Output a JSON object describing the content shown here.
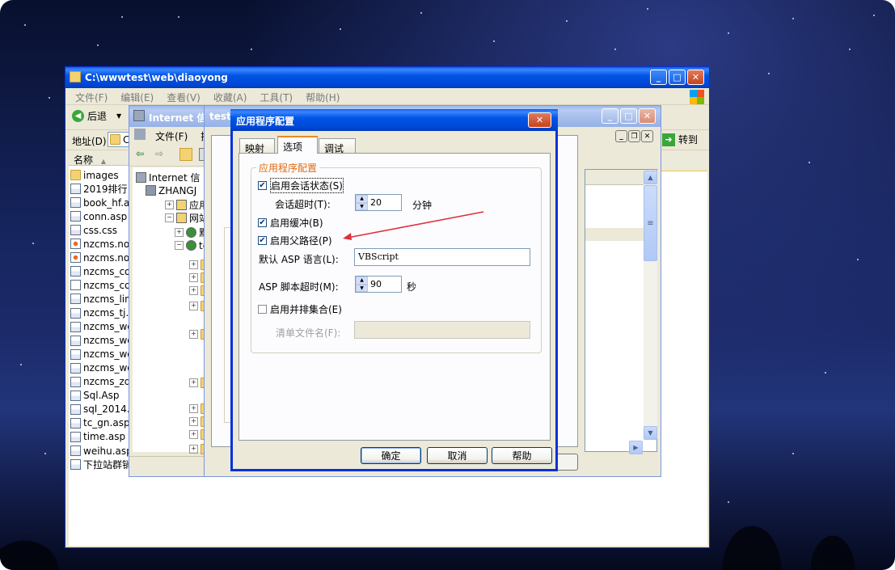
{
  "explorer": {
    "title": "C:\\wwwtest\\web\\diaoyong",
    "menu": [
      "文件(F)",
      "编辑(E)",
      "查看(V)",
      "收藏(A)",
      "工具(T)",
      "帮助(H)"
    ],
    "back_label": "后退",
    "address_label": "地址(D)",
    "address_value": "C",
    "go_label": "转到",
    "column_name": "名称",
    "files": [
      {
        "name": "images",
        "icon": "folder"
      },
      {
        "name": "2019排行",
        "icon": "asp"
      },
      {
        "name": "book_hf.a",
        "icon": "asp"
      },
      {
        "name": "conn.asp",
        "icon": "asp"
      },
      {
        "name": "css.css",
        "icon": "css"
      },
      {
        "name": "nzcms.no",
        "icon": "web"
      },
      {
        "name": "nzcms.no",
        "icon": "web"
      },
      {
        "name": "nzcms_co",
        "icon": "asp"
      },
      {
        "name": "nzcms_co",
        "icon": "page"
      },
      {
        "name": "nzcms_lin",
        "icon": "asp"
      },
      {
        "name": "nzcms_tj.",
        "icon": "asp"
      },
      {
        "name": "nzcms_we",
        "icon": "asp"
      },
      {
        "name": "nzcms_we",
        "icon": "asp"
      },
      {
        "name": "nzcms_we",
        "icon": "asp"
      },
      {
        "name": "nzcms_we",
        "icon": "asp"
      },
      {
        "name": "nzcms_zq",
        "icon": "asp"
      },
      {
        "name": "Sql.Asp",
        "icon": "asp"
      },
      {
        "name": "sql_2014.",
        "icon": "asp"
      },
      {
        "name": "tc_gn.asp",
        "icon": "asp"
      },
      {
        "name": "time.asp",
        "icon": "asp"
      },
      {
        "name": "weihu.asp",
        "icon": "asp"
      },
      {
        "name": "下拉站群销",
        "icon": "asp"
      }
    ]
  },
  "iis": {
    "title": "Internet 信",
    "menu_file": "文件(F)",
    "menu_action": "操",
    "tree": [
      {
        "label": "Internet 信",
        "indent": 0,
        "icon": "iis"
      },
      {
        "label": "ZHANGJ",
        "indent": 1,
        "icon": "server"
      },
      {
        "label": "应用",
        "indent": 2,
        "icon": "folder"
      },
      {
        "label": "网站",
        "indent": 2,
        "icon": "folder"
      },
      {
        "label": "默",
        "indent": 3,
        "icon": "site"
      },
      {
        "label": "te",
        "indent": 3,
        "icon": "site"
      }
    ]
  },
  "props": {
    "title": "test"
  },
  "dialog": {
    "title": "应用程序配置",
    "tabs": [
      "映射",
      "选项",
      "调试"
    ],
    "selected_tab": 1,
    "group_title": "应用程序配置",
    "enable_session_label": "启用会话状态(S)",
    "enable_session_checked": true,
    "session_timeout_label": "会话超时(T):",
    "session_timeout_value": "20",
    "session_timeout_unit": "分钟",
    "enable_buffer_label": "启用缓冲(B)",
    "enable_buffer_checked": true,
    "enable_parent_paths_label": "启用父路径(P)",
    "enable_parent_paths_checked": true,
    "default_lang_label": "默认 ASP 语言(L):",
    "default_lang_value": "VBScript",
    "script_timeout_label": "ASP 脚本超时(M):",
    "script_timeout_value": "90",
    "script_timeout_unit": "秒",
    "side_by_side_label": "启用并排集合(E)",
    "side_by_side_checked": false,
    "manifest_label": "清单文件名(F):",
    "manifest_value": "",
    "ok_label": "确定",
    "cancel_label": "取消",
    "help_label": "帮助"
  },
  "colors": {
    "accent_arrow": "#e0303a",
    "xp_blue": "#0055e5",
    "tab_highlight": "#e68b2c"
  }
}
